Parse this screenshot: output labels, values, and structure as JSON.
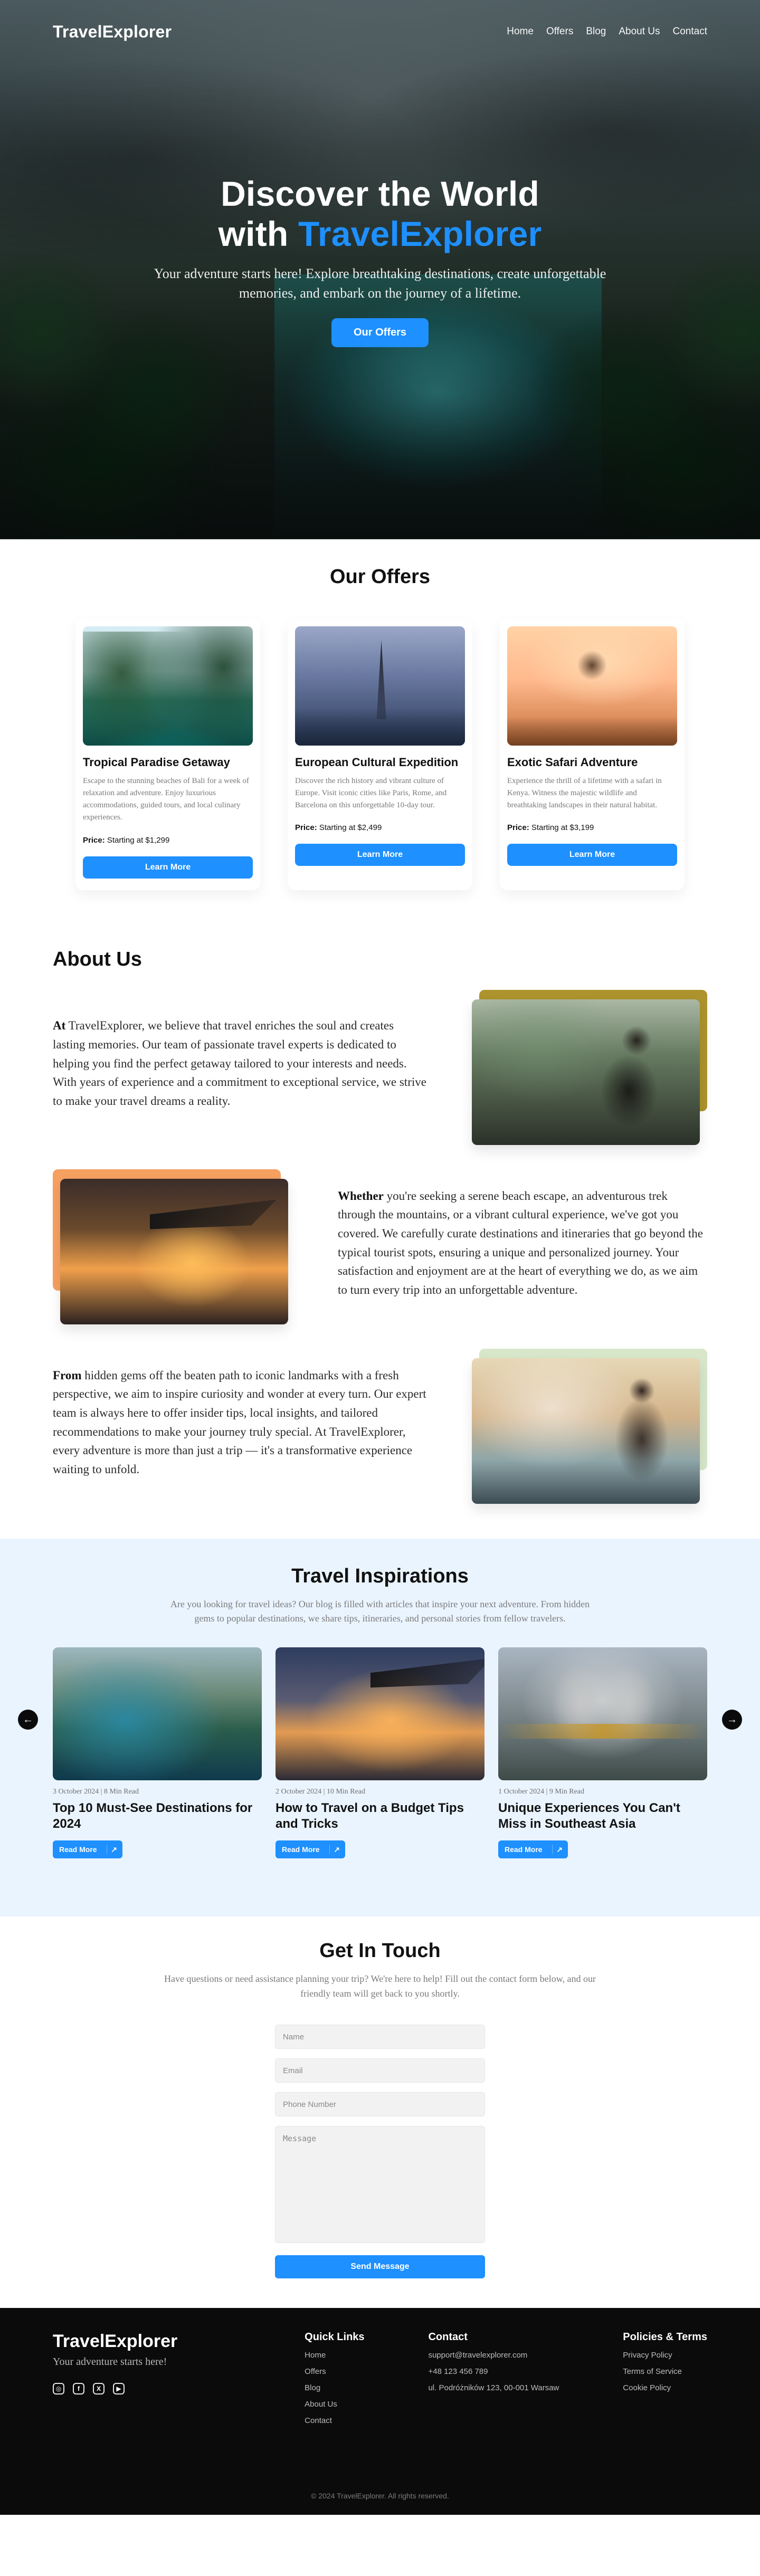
{
  "colors": {
    "primary": "#1E90FF",
    "hero_accent": "#1E90FF",
    "inspirations_bg": "#EAF4FF",
    "footer_bg": "#0B0B0B",
    "about_back_1": "#A88D22",
    "about_back_2": "#F59B59",
    "about_back_3": "#D6E6C7"
  },
  "header": {
    "brand": "TravelExplorer",
    "nav": [
      "Home",
      "Offers",
      "Blog",
      "About Us",
      "Contact"
    ]
  },
  "hero": {
    "title_prefix": "Discover the World",
    "title_with": "with",
    "title_accent": "TravelExplorer",
    "subtitle": "Your adventure starts here! Explore breathtaking destinations, create unforgettable memories, and embark on the journey of a lifetime.",
    "cta": "Our Offers"
  },
  "offers": {
    "title": "Our Offers",
    "items": [
      {
        "title": "Tropical Paradise Getaway",
        "desc": "Escape to the stunning beaches of Bali for a week of relaxation and adventure. Enjoy luxurious accommodations, guided tours, and local culinary experiences.",
        "price_label": "Price:",
        "price_value": "Starting at $1,299",
        "button": "Learn More"
      },
      {
        "title": "European Cultural Expedition",
        "desc": "Discover the rich history and vibrant culture of Europe. Visit iconic cities like Paris, Rome, and Barcelona on this unforgettable 10-day tour.",
        "price_label": "Price:",
        "price_value": "Starting at $2,499",
        "button": "Learn More"
      },
      {
        "title": "Exotic Safari Adventure",
        "desc": "Experience the thrill of a lifetime with a safari in Kenya. Witness the majestic wildlife and breathtaking landscapes in their natural habitat.",
        "price_label": "Price:",
        "price_value": "Starting at $3,199",
        "button": "Learn More"
      }
    ]
  },
  "about": {
    "title": "About Us",
    "blocks": [
      {
        "lead": "At",
        "text": " TravelExplorer, we believe that travel enriches the soul and creates lasting memories. Our team of passionate travel experts is dedicated to helping you find the perfect getaway tailored to your interests and needs. With years of experience and a commitment to exceptional service, we strive to make your travel dreams a reality."
      },
      {
        "lead": "Whether",
        "text": " you're seeking a serene beach escape, an adventurous trek through the mountains, or a vibrant cultural experience, we've got you covered. We carefully curate destinations and itineraries that go beyond the typical tourist spots, ensuring a unique and personalized journey. Your satisfaction and enjoyment are at the heart of everything we do, as we aim to turn every trip into an unforgettable adventure."
      },
      {
        "lead": "From",
        "text": " hidden gems off the beaten path to iconic landmarks with a fresh perspective, we aim to inspire curiosity and wonder at every turn. Our expert team is always here to offer insider tips, local insights, and tailored recommendations to make your journey truly special. At TravelExplorer, every adventure is more than just a trip — it's a transformative experience waiting to unfold."
      }
    ]
  },
  "inspirations": {
    "title": "Travel Inspirations",
    "subtitle": "Are you looking for travel ideas? Our blog is filled with articles that inspire your next adventure. From hidden gems to popular destinations, we share tips, itineraries, and personal stories from fellow travelers.",
    "posts": [
      {
        "meta": "3 October 2024  |  8 Min Read",
        "title": "Top 10 Must-See Destinations for 2024",
        "button": "Read More"
      },
      {
        "meta": "2 October 2024  |  10 Min Read",
        "title": "How to Travel on a Budget Tips and Tricks",
        "button": "Read More"
      },
      {
        "meta": "1 October 2024  |  9 Min Read",
        "title": "Unique Experiences You Can't Miss in Southeast Asia",
        "button": "Read More"
      }
    ],
    "arrows": {
      "left": "←",
      "right": "→"
    }
  },
  "contact": {
    "title": "Get In Touch",
    "subtitle": "Have questions or need assistance planning your trip? We're here to help! Fill out the contact form below, and our friendly team will get back to you shortly.",
    "placeholders": {
      "name": "Name",
      "email": "Email",
      "phone": "Phone Number",
      "message": "Message"
    },
    "button": "Send Message"
  },
  "footer": {
    "brand": "TravelExplorer",
    "tagline": "Your adventure starts here!",
    "quick_links_title": "Quick Links",
    "quick_links": [
      "Home",
      "Offers",
      "Blog",
      "About Us",
      "Contact"
    ],
    "contact_title": "Contact",
    "contact_items": [
      "support@travelexplorer.com",
      "+48 123 456 789",
      "ul. Podróżników 123, 00-001 Warsaw"
    ],
    "policies_title": "Policies & Terms",
    "policies": [
      "Privacy Policy",
      "Terms of Service",
      "Cookie Policy"
    ],
    "copyright": "© 2024 TravelExplorer. All rights reserved.",
    "social_icons": [
      "instagram-icon",
      "facebook-icon",
      "x-icon",
      "youtube-icon"
    ]
  }
}
